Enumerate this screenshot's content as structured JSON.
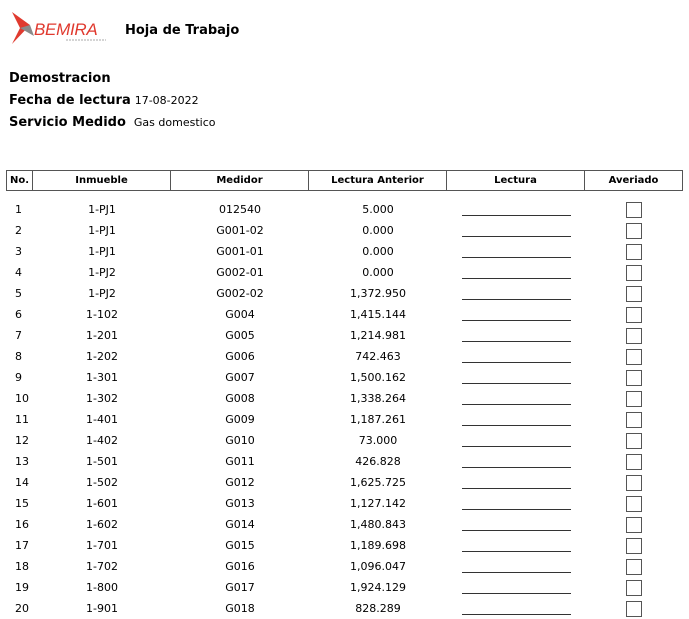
{
  "header": {
    "logo_text": "BEMIRA",
    "title": "Hoja de Trabajo"
  },
  "info": {
    "company": "Demostracion",
    "date_label": "Fecha de lectura",
    "date_value": "17-08-2022",
    "service_label": "Servicio Medido",
    "service_value": "Gas domestico"
  },
  "columns": [
    "No.",
    "Inmueble",
    "Medidor",
    "Lectura Anterior",
    "Lectura",
    "Averiado"
  ],
  "rows": [
    {
      "no": "1",
      "inmueble": "1-PJ1",
      "medidor": "012540",
      "anterior": "5.000"
    },
    {
      "no": "2",
      "inmueble": "1-PJ1",
      "medidor": "G001-02",
      "anterior": "0.000"
    },
    {
      "no": "3",
      "inmueble": "1-PJ1",
      "medidor": "G001-01",
      "anterior": "0.000"
    },
    {
      "no": "4",
      "inmueble": "1-PJ2",
      "medidor": "G002-01",
      "anterior": "0.000"
    },
    {
      "no": "5",
      "inmueble": "1-PJ2",
      "medidor": "G002-02",
      "anterior": "1,372.950"
    },
    {
      "no": "6",
      "inmueble": "1-102",
      "medidor": "G004",
      "anterior": "1,415.144"
    },
    {
      "no": "7",
      "inmueble": "1-201",
      "medidor": "G005",
      "anterior": "1,214.981"
    },
    {
      "no": "8",
      "inmueble": "1-202",
      "medidor": "G006",
      "anterior": "742.463"
    },
    {
      "no": "9",
      "inmueble": "1-301",
      "medidor": "G007",
      "anterior": "1,500.162"
    },
    {
      "no": "10",
      "inmueble": "1-302",
      "medidor": "G008",
      "anterior": "1,338.264"
    },
    {
      "no": "11",
      "inmueble": "1-401",
      "medidor": "G009",
      "anterior": "1,187.261"
    },
    {
      "no": "12",
      "inmueble": "1-402",
      "medidor": "G010",
      "anterior": "73.000"
    },
    {
      "no": "13",
      "inmueble": "1-501",
      "medidor": "G011",
      "anterior": "426.828"
    },
    {
      "no": "14",
      "inmueble": "1-502",
      "medidor": "G012",
      "anterior": "1,625.725"
    },
    {
      "no": "15",
      "inmueble": "1-601",
      "medidor": "G013",
      "anterior": "1,127.142"
    },
    {
      "no": "16",
      "inmueble": "1-602",
      "medidor": "G014",
      "anterior": "1,480.843"
    },
    {
      "no": "17",
      "inmueble": "1-701",
      "medidor": "G015",
      "anterior": "1,189.698"
    },
    {
      "no": "18",
      "inmueble": "1-702",
      "medidor": "G016",
      "anterior": "1,096.047"
    },
    {
      "no": "19",
      "inmueble": "1-800",
      "medidor": "G017",
      "anterior": "1,924.129"
    },
    {
      "no": "20",
      "inmueble": "1-901",
      "medidor": "G018",
      "anterior": "828.289"
    }
  ],
  "colors": {
    "logo_red": "#e03a2f",
    "logo_gray": "#888888",
    "border": "#555555"
  }
}
